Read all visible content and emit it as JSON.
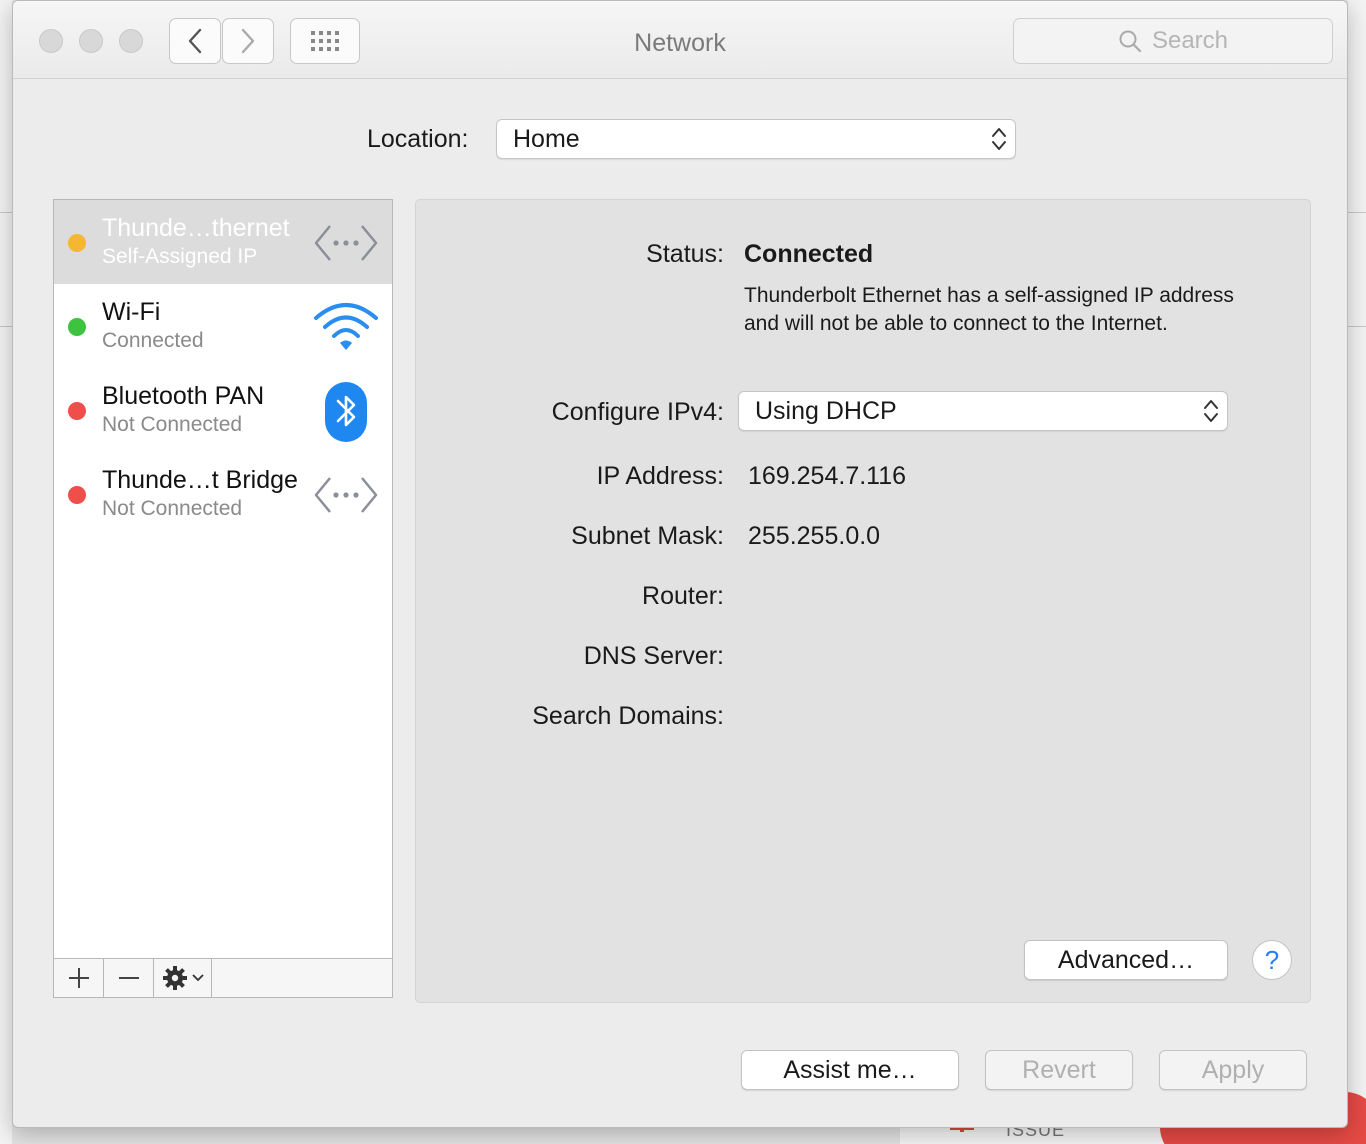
{
  "window": {
    "title": "Network",
    "search_placeholder": "Search"
  },
  "location": {
    "label": "Location:",
    "value": "Home"
  },
  "services": [
    {
      "name": "Thunde…thernet",
      "status": "Self-Assigned IP",
      "status_color": "#f5b731",
      "icon": "ethernet-arrows-icon",
      "selected": true
    },
    {
      "name": "Wi-Fi",
      "status": "Connected",
      "status_color": "#3ec33e",
      "icon": "wifi-icon",
      "selected": false
    },
    {
      "name": "Bluetooth PAN",
      "status": "Not Connected",
      "status_color": "#ef4f4a",
      "icon": "bluetooth-icon",
      "selected": false
    },
    {
      "name": "Thunde…t Bridge",
      "status": "Not Connected",
      "status_color": "#ef4f4a",
      "icon": "ethernet-arrows-icon",
      "selected": false
    }
  ],
  "service_toolbar": {
    "add": "+",
    "remove": "−"
  },
  "details": {
    "status_label": "Status:",
    "status_value": "Connected",
    "status_description": "Thunderbolt Ethernet has a self-assigned IP address and will not be able to connect to the Internet.",
    "configure_label": "Configure IPv4:",
    "configure_value": "Using DHCP",
    "ip_label": "IP Address:",
    "ip_value": "169.254.7.116",
    "subnet_label": "Subnet Mask:",
    "subnet_value": "255.255.0.0",
    "router_label": "Router:",
    "dns_label": "DNS Server:",
    "search_domains_label": "Search Domains:",
    "advanced_button": "Advanced…",
    "help_button": "?"
  },
  "footer": {
    "assist_button": "Assist me…",
    "revert_button": "Revert",
    "apply_button": "Apply"
  },
  "background": {
    "issue_text": "ISSUE"
  },
  "colors": {
    "accent": "#2a7cf0",
    "bluetooth": "#1e88f0",
    "wifi": "#2a8df0"
  }
}
